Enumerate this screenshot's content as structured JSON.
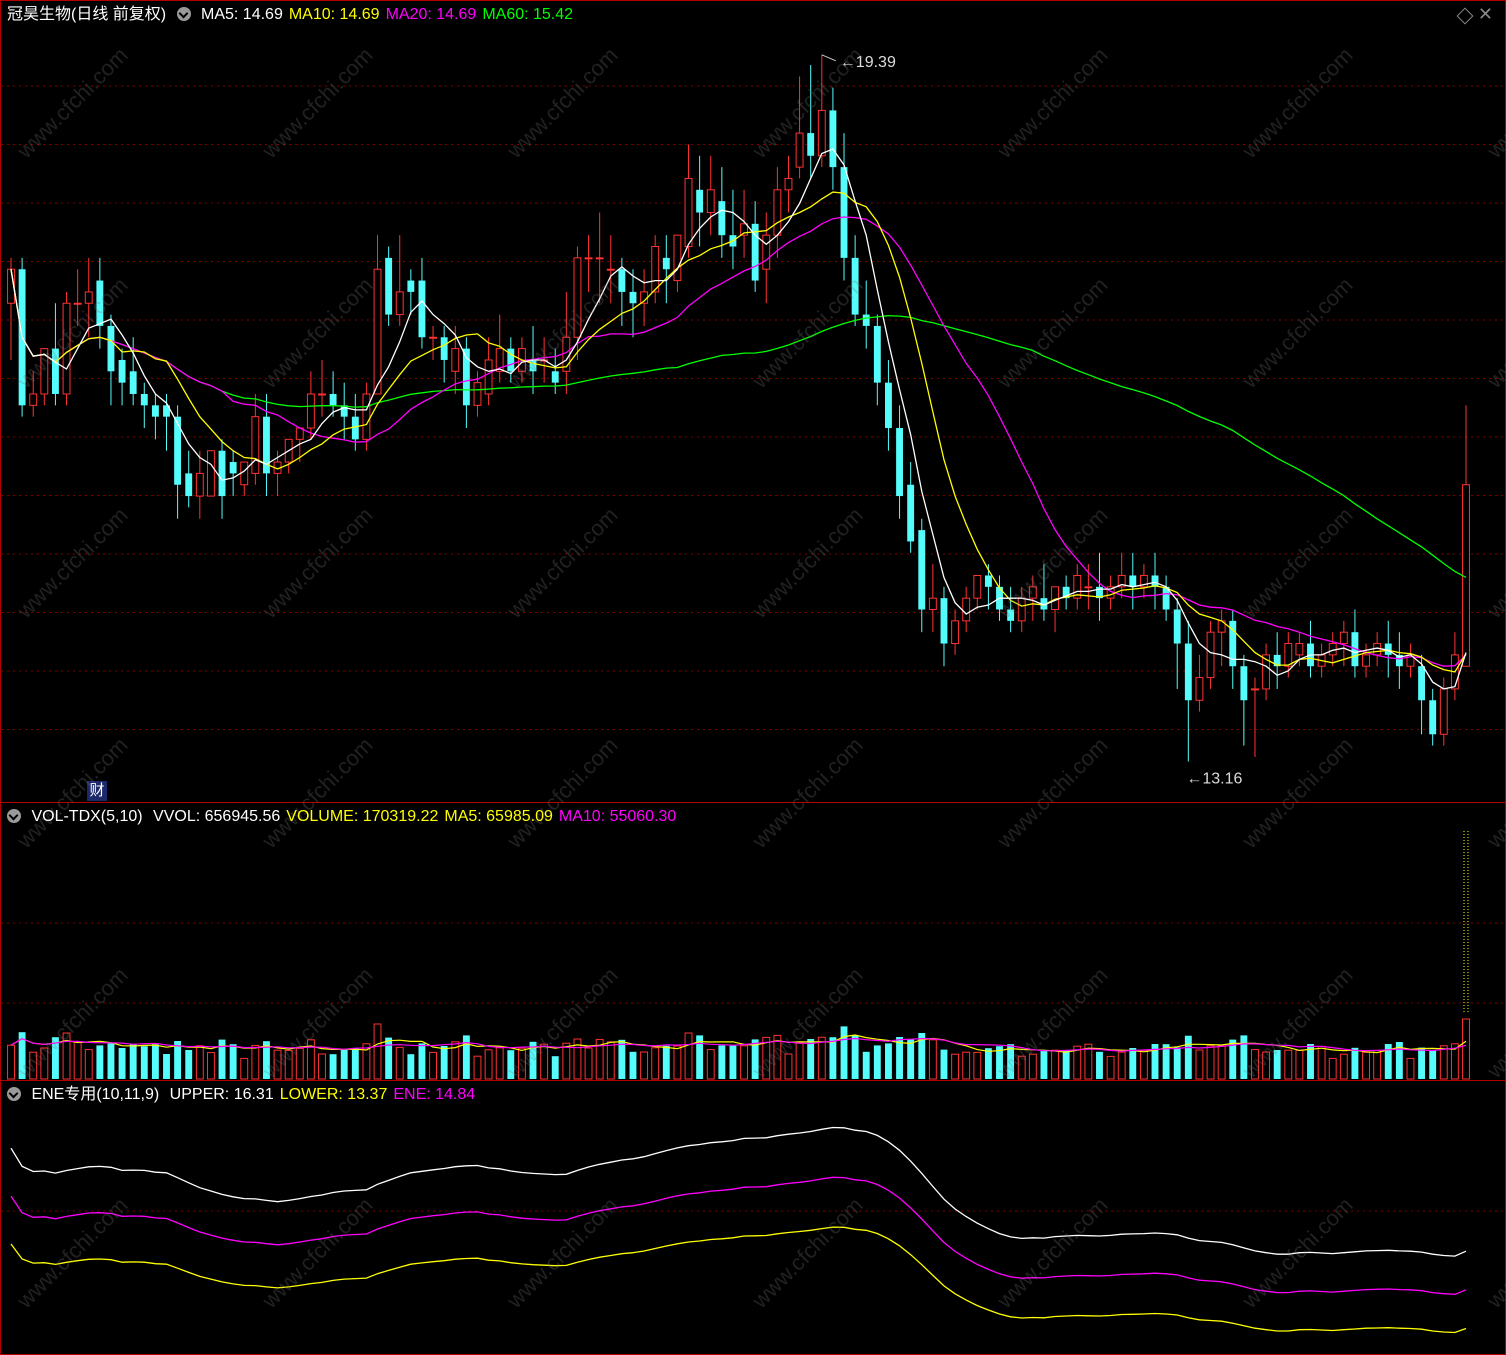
{
  "price_panel": {
    "stock_name": "冠昊生物(日线 前复权)",
    "indicators": [
      {
        "label": "MA5: 14.69",
        "color": "#ffffff"
      },
      {
        "label": "MA10: 14.69",
        "color": "#ffff00"
      },
      {
        "label": "MA20: 14.69",
        "color": "#ff00ff"
      },
      {
        "label": "MA60: 15.42",
        "color": "#00ff00"
      }
    ],
    "high_label": "19.39",
    "low_label": "13.16",
    "finance_badge": "财"
  },
  "volume_panel": {
    "title": "VOL-TDX(5,10)",
    "indicators": [
      {
        "label": "VVOL: 656945.56",
        "color": "#ffffff"
      },
      {
        "label": "VOLUME: 170319.22",
        "color": "#ffff00"
      },
      {
        "label": "MA5: 65985.09",
        "color": "#ffff00"
      },
      {
        "label": "MA10: 55060.30",
        "color": "#ff00ff"
      }
    ]
  },
  "ene_panel": {
    "title": "ENE专用(10,11,9)",
    "indicators": [
      {
        "label": "UPPER: 16.31",
        "color": "#ffffff"
      },
      {
        "label": "LOWER: 13.37",
        "color": "#ffff00"
      },
      {
        "label": "ENE: 14.84",
        "color": "#ff00ff"
      }
    ]
  },
  "watermark": "www.cfchi.com",
  "colors": {
    "up": "#ff3232",
    "down": "#54fcfc",
    "grid": "#800000",
    "border": "#b00000",
    "ma5": "#ffffff",
    "ma10": "#ffff00",
    "ma20": "#ff00ff",
    "ma60": "#00ff00"
  },
  "chart_data": {
    "type": "candlestick",
    "price_range": [
      12.9,
      19.6
    ],
    "candles": [
      [
        17.2,
        17.6,
        17.5,
        16.7
      ],
      [
        17.5,
        17.6,
        16.3,
        16.2
      ],
      [
        16.3,
        16.6,
        16.4,
        16.2
      ],
      [
        16.4,
        16.8,
        16.8,
        16.3
      ],
      [
        16.8,
        17.2,
        16.4,
        16.3
      ],
      [
        16.4,
        17.3,
        17.2,
        16.3
      ],
      [
        17.2,
        17.5,
        17.2,
        17.0
      ],
      [
        17.2,
        17.6,
        17.3,
        16.9
      ],
      [
        17.4,
        17.6,
        17.0,
        16.8
      ],
      [
        17.0,
        17.1,
        16.6,
        16.3
      ],
      [
        16.7,
        16.8,
        16.5,
        16.3
      ],
      [
        16.6,
        16.9,
        16.4,
        16.3
      ],
      [
        16.4,
        16.5,
        16.3,
        16.1
      ],
      [
        16.3,
        16.4,
        16.2,
        16.0
      ],
      [
        16.3,
        16.4,
        16.2,
        15.9
      ],
      [
        16.2,
        16.3,
        15.6,
        15.3
      ],
      [
        15.7,
        15.9,
        15.5,
        15.4
      ],
      [
        15.5,
        15.9,
        15.7,
        15.3
      ],
      [
        15.5,
        15.8,
        15.9,
        15.6
      ],
      [
        15.9,
        16.0,
        15.5,
        15.3
      ],
      [
        15.8,
        15.9,
        15.7,
        15.5
      ],
      [
        15.6,
        15.8,
        15.8,
        15.5
      ],
      [
        15.7,
        16.4,
        16.2,
        15.6
      ],
      [
        16.2,
        16.4,
        15.7,
        15.5
      ],
      [
        15.7,
        15.9,
        15.8,
        15.5
      ],
      [
        15.8,
        16.0,
        16.0,
        15.7
      ],
      [
        16.0,
        16.1,
        16.1,
        15.8
      ],
      [
        16.1,
        16.6,
        16.4,
        16.0
      ],
      [
        16.4,
        16.7,
        16.4,
        16.2
      ],
      [
        16.4,
        16.6,
        16.3,
        16.2
      ],
      [
        16.3,
        16.5,
        16.2,
        16.0
      ],
      [
        16.2,
        16.4,
        16.0,
        15.9
      ],
      [
        16.0,
        16.5,
        16.4,
        15.9
      ],
      [
        16.4,
        17.8,
        17.5,
        16.4
      ],
      [
        17.6,
        17.7,
        17.1,
        17.0
      ],
      [
        17.1,
        17.8,
        17.3,
        17.0
      ],
      [
        17.4,
        17.5,
        17.3,
        17.1
      ],
      [
        17.4,
        17.6,
        16.9,
        16.8
      ],
      [
        16.9,
        17.0,
        16.9,
        16.7
      ],
      [
        16.9,
        17.0,
        16.7,
        16.5
      ],
      [
        16.6,
        17.0,
        16.8,
        16.4
      ],
      [
        16.8,
        16.9,
        16.3,
        16.1
      ],
      [
        16.3,
        16.6,
        16.5,
        16.2
      ],
      [
        16.4,
        16.9,
        16.7,
        16.3
      ],
      [
        16.6,
        17.1,
        16.8,
        16.5
      ],
      [
        16.8,
        16.9,
        16.6,
        16.5
      ],
      [
        16.6,
        16.9,
        16.8,
        16.5
      ],
      [
        16.7,
        17.0,
        16.6,
        16.4
      ],
      [
        16.7,
        16.9,
        16.7,
        16.5
      ],
      [
        16.6,
        16.8,
        16.5,
        16.4
      ],
      [
        16.6,
        17.3,
        16.9,
        16.4
      ],
      [
        16.9,
        17.7,
        17.6,
        16.7
      ],
      [
        17.6,
        17.8,
        17.6,
        17.3
      ],
      [
        17.6,
        18.0,
        17.6,
        17.2
      ],
      [
        17.5,
        17.8,
        17.5,
        17.2
      ],
      [
        17.5,
        17.6,
        17.3,
        17.0
      ],
      [
        17.3,
        17.5,
        17.2,
        16.9
      ],
      [
        17.2,
        17.5,
        17.3,
        17.0
      ],
      [
        17.3,
        17.8,
        17.7,
        17.2
      ],
      [
        17.6,
        17.8,
        17.5,
        17.2
      ],
      [
        17.4,
        17.8,
        17.8,
        17.3
      ],
      [
        17.7,
        18.6,
        18.3,
        17.6
      ],
      [
        18.2,
        18.5,
        18.0,
        17.7
      ],
      [
        18.0,
        18.5,
        18.2,
        17.8
      ],
      [
        18.1,
        18.4,
        17.8,
        17.6
      ],
      [
        17.8,
        18.2,
        17.7,
        17.5
      ],
      [
        17.8,
        18.2,
        17.9,
        17.6
      ],
      [
        17.9,
        18.1,
        17.4,
        17.3
      ],
      [
        17.5,
        18.0,
        17.8,
        17.2
      ],
      [
        17.8,
        18.4,
        18.2,
        17.6
      ],
      [
        18.2,
        18.5,
        18.3,
        18.0
      ],
      [
        18.4,
        19.2,
        18.7,
        18.3
      ],
      [
        18.7,
        19.3,
        18.5,
        18.3
      ],
      [
        18.5,
        19.39,
        18.9,
        18.4
      ],
      [
        18.9,
        19.1,
        18.4,
        18.2
      ],
      [
        18.4,
        18.7,
        17.6,
        17.4
      ],
      [
        17.6,
        17.8,
        17.1,
        17.0
      ],
      [
        17.1,
        17.4,
        17.0,
        16.8
      ],
      [
        17.0,
        17.1,
        16.5,
        16.3
      ],
      [
        16.5,
        16.7,
        16.1,
        15.9
      ],
      [
        16.1,
        16.3,
        15.5,
        15.3
      ],
      [
        15.6,
        15.8,
        15.1,
        15.0
      ],
      [
        15.2,
        15.3,
        14.5,
        14.3
      ],
      [
        14.5,
        14.9,
        14.6,
        14.3
      ],
      [
        14.6,
        14.7,
        14.2,
        14.0
      ],
      [
        14.2,
        14.5,
        14.4,
        14.1
      ],
      [
        14.4,
        14.7,
        14.6,
        14.3
      ],
      [
        14.6,
        14.8,
        14.8,
        14.5
      ],
      [
        14.8,
        14.9,
        14.7,
        14.5
      ],
      [
        14.7,
        14.8,
        14.5,
        14.4
      ],
      [
        14.5,
        14.7,
        14.4,
        14.3
      ],
      [
        14.4,
        14.7,
        14.6,
        14.3
      ],
      [
        14.6,
        14.8,
        14.7,
        14.4
      ],
      [
        14.6,
        14.9,
        14.5,
        14.4
      ],
      [
        14.5,
        14.7,
        14.7,
        14.3
      ],
      [
        14.7,
        14.8,
        14.6,
        14.5
      ],
      [
        14.6,
        14.9,
        14.8,
        14.5
      ],
      [
        14.7,
        14.9,
        14.7,
        14.5
      ],
      [
        14.7,
        15.0,
        14.6,
        14.4
      ],
      [
        14.6,
        14.8,
        14.7,
        14.5
      ],
      [
        14.7,
        15.0,
        14.8,
        14.6
      ],
      [
        14.8,
        15.0,
        14.7,
        14.5
      ],
      [
        14.7,
        14.9,
        14.8,
        14.6
      ],
      [
        14.8,
        15.0,
        14.7,
        14.5
      ],
      [
        14.7,
        14.8,
        14.5,
        14.4
      ],
      [
        14.5,
        14.6,
        14.2,
        13.8
      ],
      [
        14.2,
        14.4,
        13.7,
        13.16
      ],
      [
        13.7,
        14.1,
        13.9,
        13.6
      ],
      [
        13.9,
        14.4,
        14.3,
        13.8
      ],
      [
        14.3,
        14.5,
        14.4,
        14.0
      ],
      [
        14.4,
        14.5,
        14.0,
        13.8
      ],
      [
        14.0,
        14.1,
        13.7,
        13.3
      ],
      [
        13.8,
        13.9,
        13.8,
        13.2
      ],
      [
        13.8,
        14.2,
        14.1,
        13.7
      ],
      [
        14.1,
        14.3,
        14.0,
        13.8
      ],
      [
        14.0,
        14.3,
        14.2,
        13.9
      ],
      [
        14.1,
        14.3,
        14.2,
        14.0
      ],
      [
        14.2,
        14.4,
        14.0,
        13.9
      ],
      [
        14.0,
        14.2,
        14.1,
        13.9
      ],
      [
        14.1,
        14.3,
        14.2,
        14.0
      ],
      [
        14.2,
        14.4,
        14.3,
        14.0
      ],
      [
        14.3,
        14.5,
        14.0,
        13.9
      ],
      [
        14.0,
        14.2,
        14.1,
        13.9
      ],
      [
        14.1,
        14.3,
        14.2,
        14.0
      ],
      [
        14.2,
        14.4,
        14.1,
        13.9
      ],
      [
        14.1,
        14.3,
        14.0,
        13.8
      ],
      [
        14.0,
        14.2,
        14.1,
        13.9
      ],
      [
        14.0,
        14.1,
        13.7,
        13.4
      ],
      [
        13.7,
        13.8,
        13.4,
        13.3
      ],
      [
        13.4,
        13.9,
        13.8,
        13.3
      ],
      [
        13.8,
        14.3,
        14.1,
        13.7
      ],
      [
        14.0,
        16.3,
        15.6,
        14.0
      ]
    ],
    "volume_ma_color": {
      "ma5": "#ffff00",
      "ma10": "#ff00ff"
    }
  }
}
